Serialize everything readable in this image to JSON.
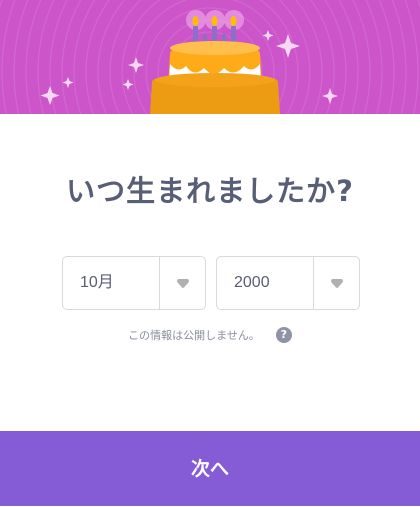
{
  "hero": {
    "image": "birthday-cake-icon",
    "background": "#cc55c9"
  },
  "title": "いつ生まれましたか?",
  "month_select": {
    "value": "10月",
    "icon": "chevron-down-icon"
  },
  "year_select": {
    "value": "2000",
    "icon": "chevron-down-icon"
  },
  "privacy_note": "この情報は公開しません。",
  "help_icon": {
    "glyph": "?",
    "name": "question-icon"
  },
  "next_button": {
    "label": "次へ",
    "color": "#855cd6"
  },
  "colors": {
    "text": "#575e75",
    "accent": "#855cd6",
    "cake": "#ffab19"
  }
}
